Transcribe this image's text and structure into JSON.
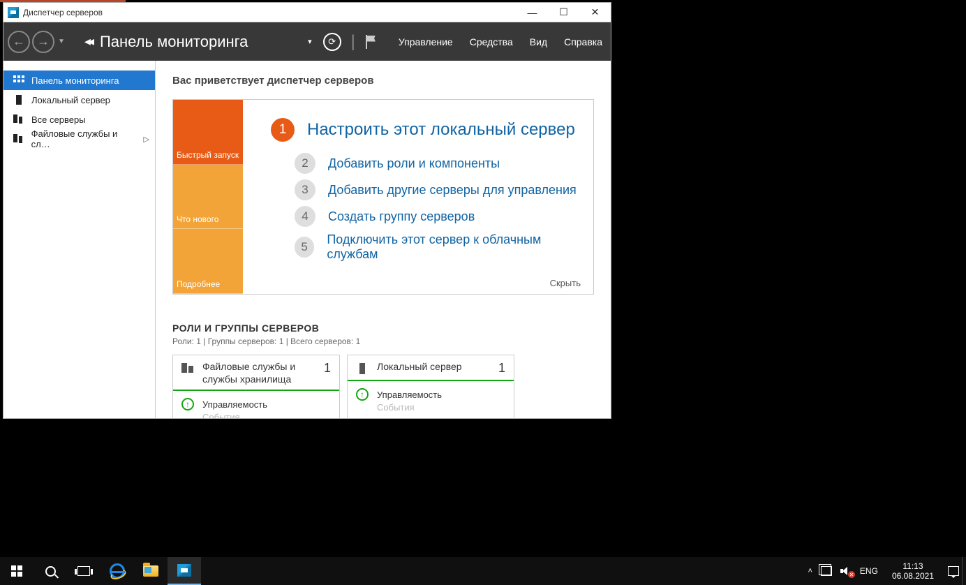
{
  "window": {
    "title": "Диспетчер серверов"
  },
  "toolbar": {
    "breadcrumb": "Панель мониторинга",
    "menus": {
      "manage": "Управление",
      "tools": "Средства",
      "view": "Вид",
      "help": "Справка"
    }
  },
  "sidebar": {
    "items": [
      {
        "label": "Панель мониторинга"
      },
      {
        "label": "Локальный сервер"
      },
      {
        "label": "Все серверы"
      },
      {
        "label": "Файловые службы и сл…"
      }
    ]
  },
  "main": {
    "welcome": "Вас приветствует диспетчер серверов",
    "tiles": {
      "quick": "Быстрый запуск",
      "new": "Что нового",
      "more": "Подробнее"
    },
    "steps": [
      {
        "n": "1",
        "label": "Настроить этот локальный сервер"
      },
      {
        "n": "2",
        "label": "Добавить роли и компоненты"
      },
      {
        "n": "3",
        "label": "Добавить другие серверы для управления"
      },
      {
        "n": "4",
        "label": "Создать группу серверов"
      },
      {
        "n": "5",
        "label": "Подключить этот сервер к облачным службам"
      }
    ],
    "hide": "Скрыть",
    "roles_heading": "РОЛИ И ГРУППЫ СЕРВЕРОВ",
    "roles_sub": "Роли: 1 | Группы серверов: 1 | Всего серверов: 1",
    "cards": [
      {
        "title": "Файловые службы и службы хранилища",
        "count": "1",
        "row1": "Управляемость",
        "row2": "События"
      },
      {
        "title": "Локальный сервер",
        "count": "1",
        "row1": "Управляемость",
        "row2": "События"
      }
    ]
  },
  "taskbar": {
    "lang": "ENG",
    "time": "11:13",
    "date": "06.08.2021"
  }
}
